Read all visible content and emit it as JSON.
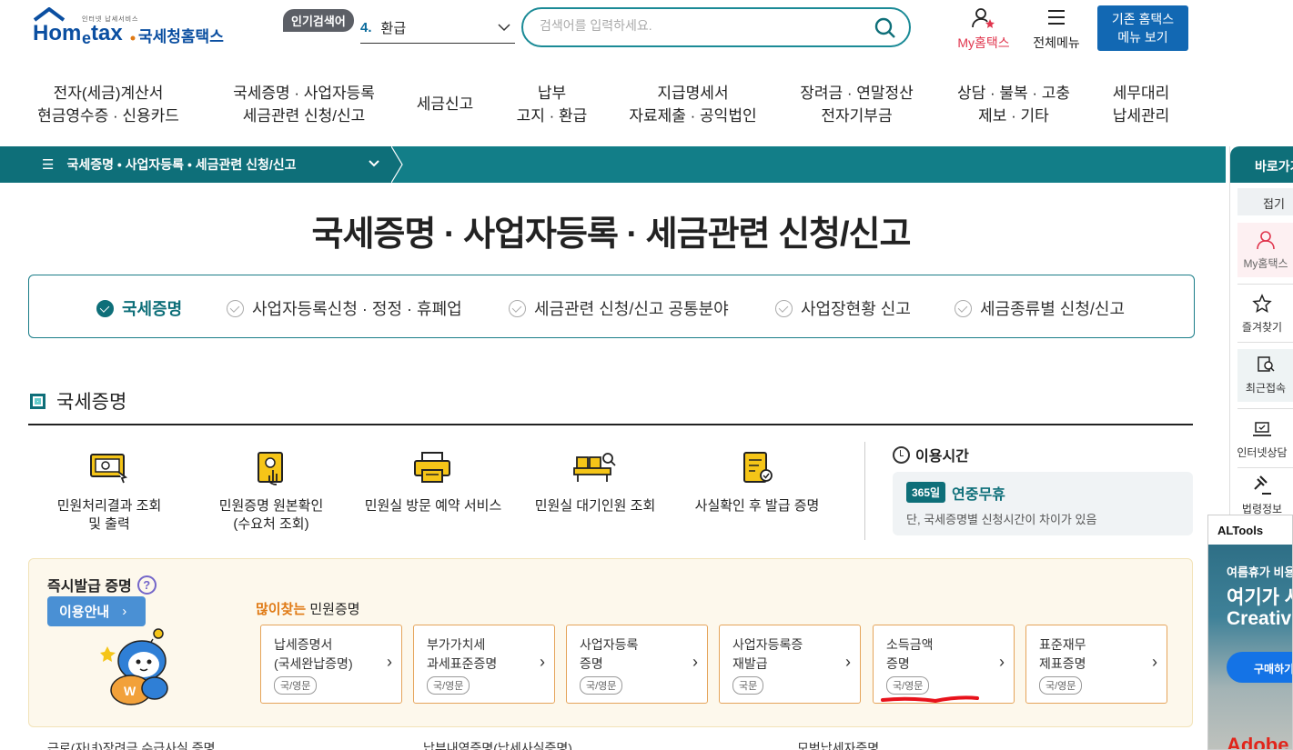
{
  "header": {
    "logo_small": "인터넷 납세서비스",
    "logo_text": "국세청홈택스",
    "popular_tag": "인기검색어",
    "popular_rank": "4.",
    "popular_word": "환급",
    "search_placeholder": "검색어를 입력하세요.",
    "my_hometax": "My홈택스",
    "all_menu": "전체메뉴",
    "old_hometax_line1": "기존 홈택스",
    "old_hometax_line2": "메뉴 보기"
  },
  "gnb": [
    {
      "line1": "전자(세금)계산서",
      "line2": "현금영수증 · 신용카드"
    },
    {
      "line1": "국세증명 · 사업자등록",
      "line2": "세금관련 신청/신고"
    },
    {
      "line1": "세금신고",
      "line2": ""
    },
    {
      "line1": "납부",
      "line2": "고지 · 환급"
    },
    {
      "line1": "지급명세서",
      "line2": "자료제출 · 공익법인"
    },
    {
      "line1": "장려금 · 연말정산",
      "line2": "전자기부금"
    },
    {
      "line1": "상담 · 불복 · 고충",
      "line2": "제보 · 기타"
    },
    {
      "line1": "세무대리",
      "line2": "납세관리"
    }
  ],
  "breadcrumb": {
    "current": "국세증명 • 사업자등록 • 세금관련 신청/신고"
  },
  "page_title": "국세증명 · 사업자등록 · 세금관련 신청/신고",
  "tabs": [
    {
      "label": "국세증명",
      "active": true
    },
    {
      "label": "사업자등록신청 · 정정 · 휴폐업",
      "active": false
    },
    {
      "label": "세금관련 신청/신고 공통분야",
      "active": false
    },
    {
      "label": "사업장현황 신고",
      "active": false
    },
    {
      "label": "세금종류별 신청/신고",
      "active": false
    }
  ],
  "section": {
    "title": "국세증명"
  },
  "services": [
    {
      "line1": "민원처리결과 조회",
      "line2": "및 출력",
      "icon": "monitor-icon"
    },
    {
      "line1": "민원증명 원본확인",
      "line2": "(수요처 조회)",
      "icon": "document-touch-icon"
    },
    {
      "line1": "민원실 방문 예약 서비스",
      "line2": "",
      "icon": "printer-icon"
    },
    {
      "line1": "민원실 대기인원 조회",
      "line2": "",
      "icon": "counter-search-icon"
    },
    {
      "line1": "사실확인 후 발급 증명",
      "line2": "",
      "icon": "certificate-icon"
    }
  ],
  "hours": {
    "title": "이용시간",
    "badge": "365일",
    "main": "연중무휴",
    "note": "단, 국세증명별 신청시간이 차이가 있음"
  },
  "instant": {
    "title": "즉시발급 증명",
    "help": "?",
    "guide_button": "이용안내",
    "popular_prefix": "많이찾는",
    "popular_suffix": " 민원증명",
    "certs": [
      {
        "line1": "납세증명서",
        "line2": "(국세완납증명)",
        "tag": "국/영문"
      },
      {
        "line1": "부가가치세",
        "line2": "과세표준증명",
        "tag": "국/영문"
      },
      {
        "line1": "사업자등록",
        "line2": "증명",
        "tag": "국/영문"
      },
      {
        "line1": "사업자등록증",
        "line2": "재발급",
        "tag": "국문"
      },
      {
        "line1": "소득금액",
        "line2": "증명",
        "tag": "국/영문"
      },
      {
        "line1": "표준재무",
        "line2": "제표증명",
        "tag": "국/영문"
      }
    ],
    "accent_color": "#e0354d"
  },
  "bottom_links": [
    "근로(자녀)장려금 수급사실 증명",
    "납부내역증명(납세사실증명)",
    "모범납세자증명"
  ],
  "quickbar": {
    "title": "바로가기",
    "fold": "접기",
    "items": [
      "My홈택스",
      "즐겨찾기",
      "최근접속",
      "인터넷상담",
      "법령정보"
    ]
  },
  "ad": {
    "header": "ALTools",
    "line1": "여름휴가 비용",
    "line2": "여기가 사",
    "line3": "Creative",
    "button": "구매하기",
    "brand": "Adobe"
  },
  "colors": {
    "teal": "#0e6f79",
    "brand_blue": "#0b4fa1",
    "button_blue": "#1268b3",
    "popular_orange": "#e07a15"
  }
}
